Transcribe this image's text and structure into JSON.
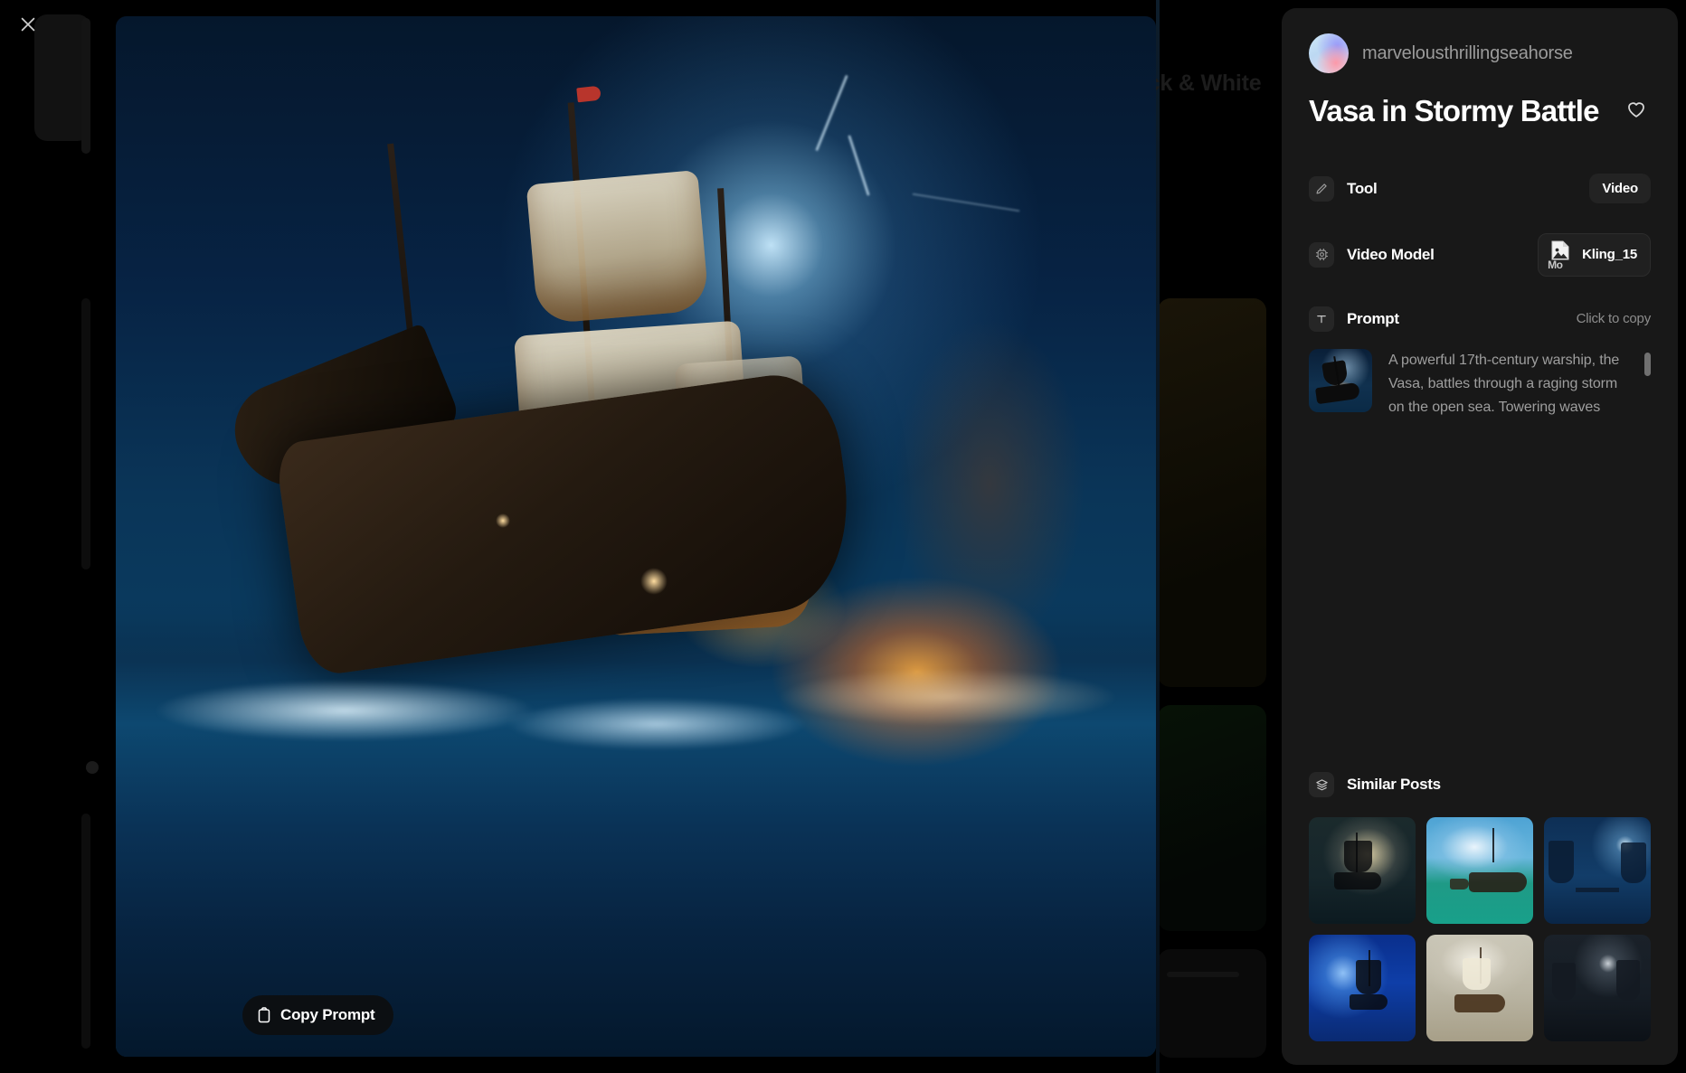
{
  "backdrop": {
    "category_label_partial": "ack & White"
  },
  "close_button": {
    "icon": "close-icon",
    "label": "Close"
  },
  "media": {
    "copy_prompt_label": "Copy Prompt",
    "copy_prompt_icon": "clipboard-icon",
    "artwork_alt": "Vasa in Stormy Battle"
  },
  "panel": {
    "author": {
      "avatar_icon": "avatar",
      "username": "marvelousthrillingseahorse"
    },
    "title": "Vasa in Stormy Battle",
    "like_icon": "heart-icon",
    "meta": {
      "tool": {
        "icon": "pencil-icon",
        "label": "Tool",
        "value": "Video"
      },
      "video_model": {
        "icon": "gear-icon",
        "label": "Video Model",
        "value": "Kling_15",
        "badge_icon": "broken-image-icon",
        "badge_alt_text": "Mo"
      },
      "prompt": {
        "icon": "text-icon",
        "label": "Prompt",
        "copy_hint": "Click to copy",
        "thumbnail_icon": "prompt-thumbnail",
        "text": "A powerful 17th-century warship, the Vasa, battles through a raging storm on the open sea. Towering waves"
      }
    },
    "similar": {
      "icon": "layers-icon",
      "label": "Similar Posts",
      "items": [
        {
          "alt": "Ghost galleon in a sea cave"
        },
        {
          "alt": "Steamship and sailing vessel in daylight"
        },
        {
          "alt": "Moonlit pier with tall ships"
        },
        {
          "alt": "Blue moon over a sailing ship"
        },
        {
          "alt": "Galleon beached on a shore"
        },
        {
          "alt": "Foggy moonlit harbour pier"
        }
      ]
    }
  },
  "colors": {
    "panel_bg": "#181818",
    "page_bg": "#000000",
    "text_primary": "#ffffff",
    "text_secondary": "#9b9b9b",
    "pill_bg": "#232323"
  }
}
